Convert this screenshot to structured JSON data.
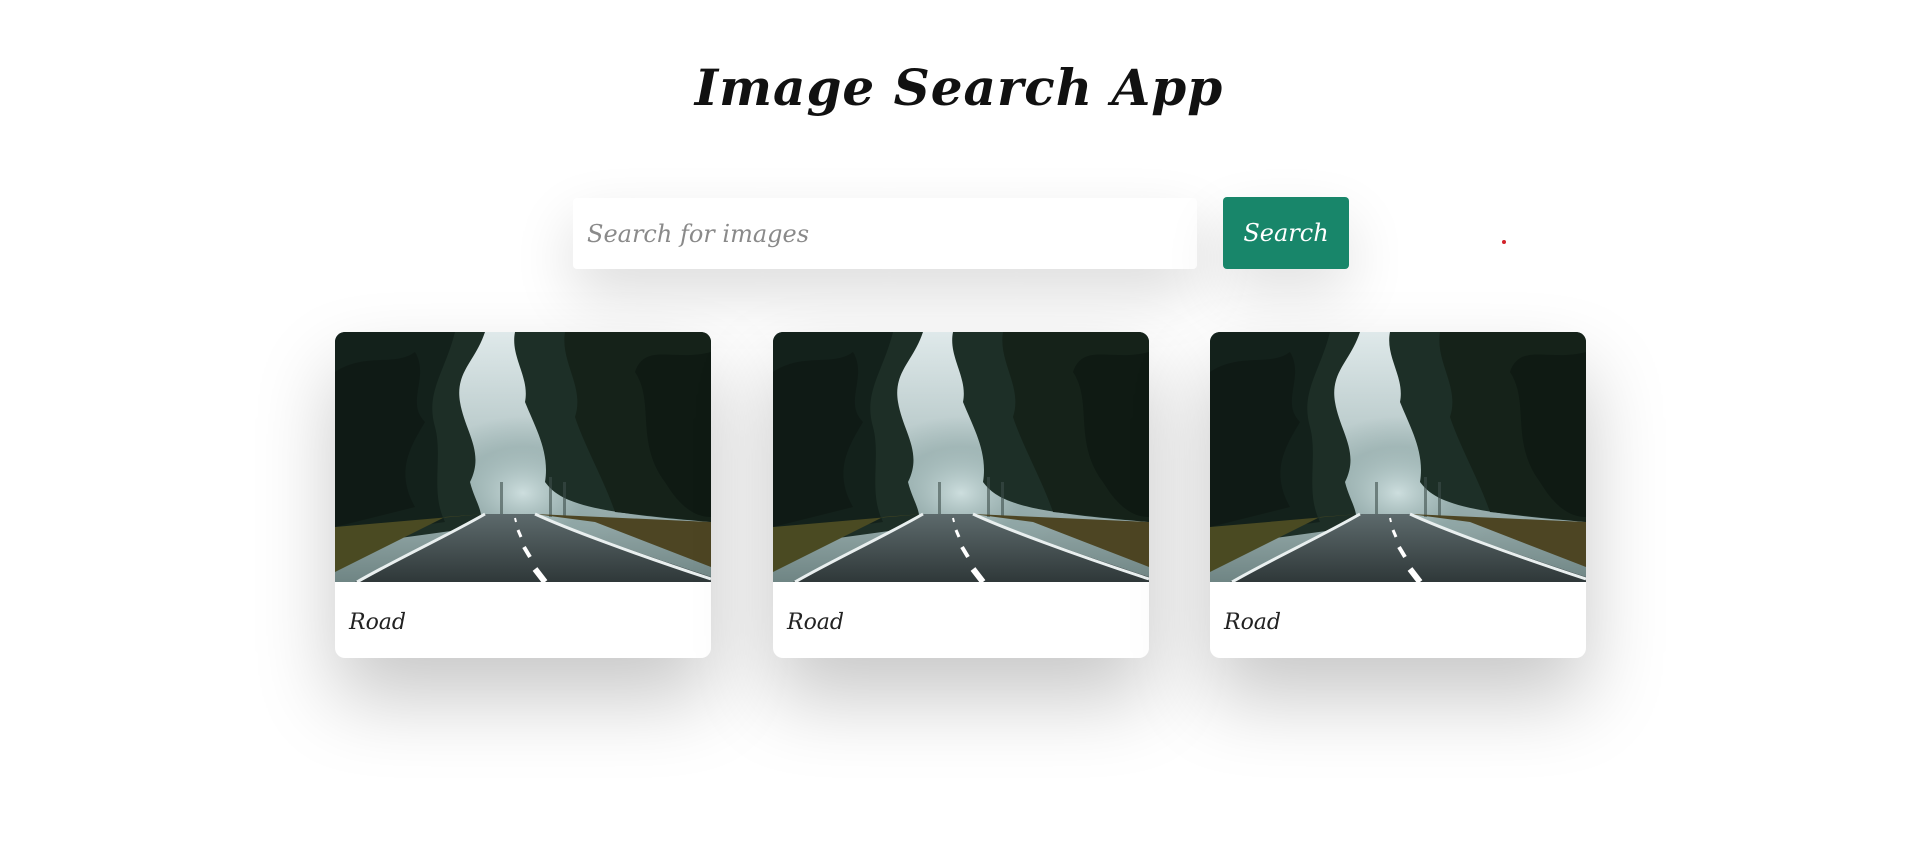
{
  "app": {
    "title": "Image Search App"
  },
  "search": {
    "placeholder": "Search for images",
    "value": "",
    "button_label": "Search"
  },
  "results": [
    {
      "caption": "Road"
    },
    {
      "caption": "Road"
    },
    {
      "caption": "Road"
    }
  ],
  "colors": {
    "accent": "#18866a",
    "dot": "#d2222a"
  }
}
